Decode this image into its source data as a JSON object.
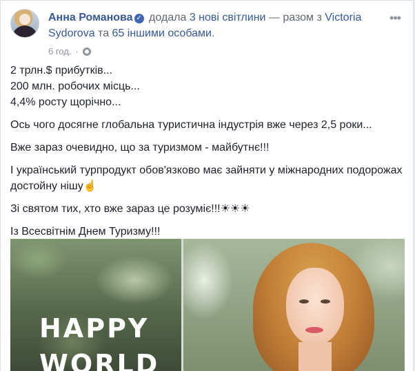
{
  "post": {
    "author": "Анна Романова",
    "action": "додала",
    "photos_link": "3 нові світлини",
    "with_text": "— разом з",
    "tagged_person": "Victoria Sydorova",
    "and_text": "та",
    "others_link": "65 іншими особами",
    "period": ".",
    "time": "6 год.",
    "time_separator": "·",
    "lines": [
      "2 трлн.$ прибутків...",
      "200 млн. робочих місць...",
      "4,4% росту щорічно..."
    ],
    "paragraphs": [
      "Ось чого досягне глобальна туристична індустрія вже через 2,5 роки...",
      "Вже зараз очевидно, що за туризмом - майбутнє!!!",
      "І український турпродукт обов'язково має зайняти у міжнародних подорожах достойну нішу☝",
      "Зі святом тих, хто вже зараз це розуміє!!!☀☀☀",
      "Із Всесвітнім Днем Туризму!!!"
    ],
    "image_text": [
      "HAPPY",
      "WORLD"
    ]
  },
  "icons": {
    "verified": "verified-badge-icon",
    "audience": "globe-icon",
    "more": "more-options-icon"
  },
  "colors": {
    "link": "#365899",
    "text": "#1d2129",
    "meta": "#90949c",
    "verified": "#4267b2"
  }
}
